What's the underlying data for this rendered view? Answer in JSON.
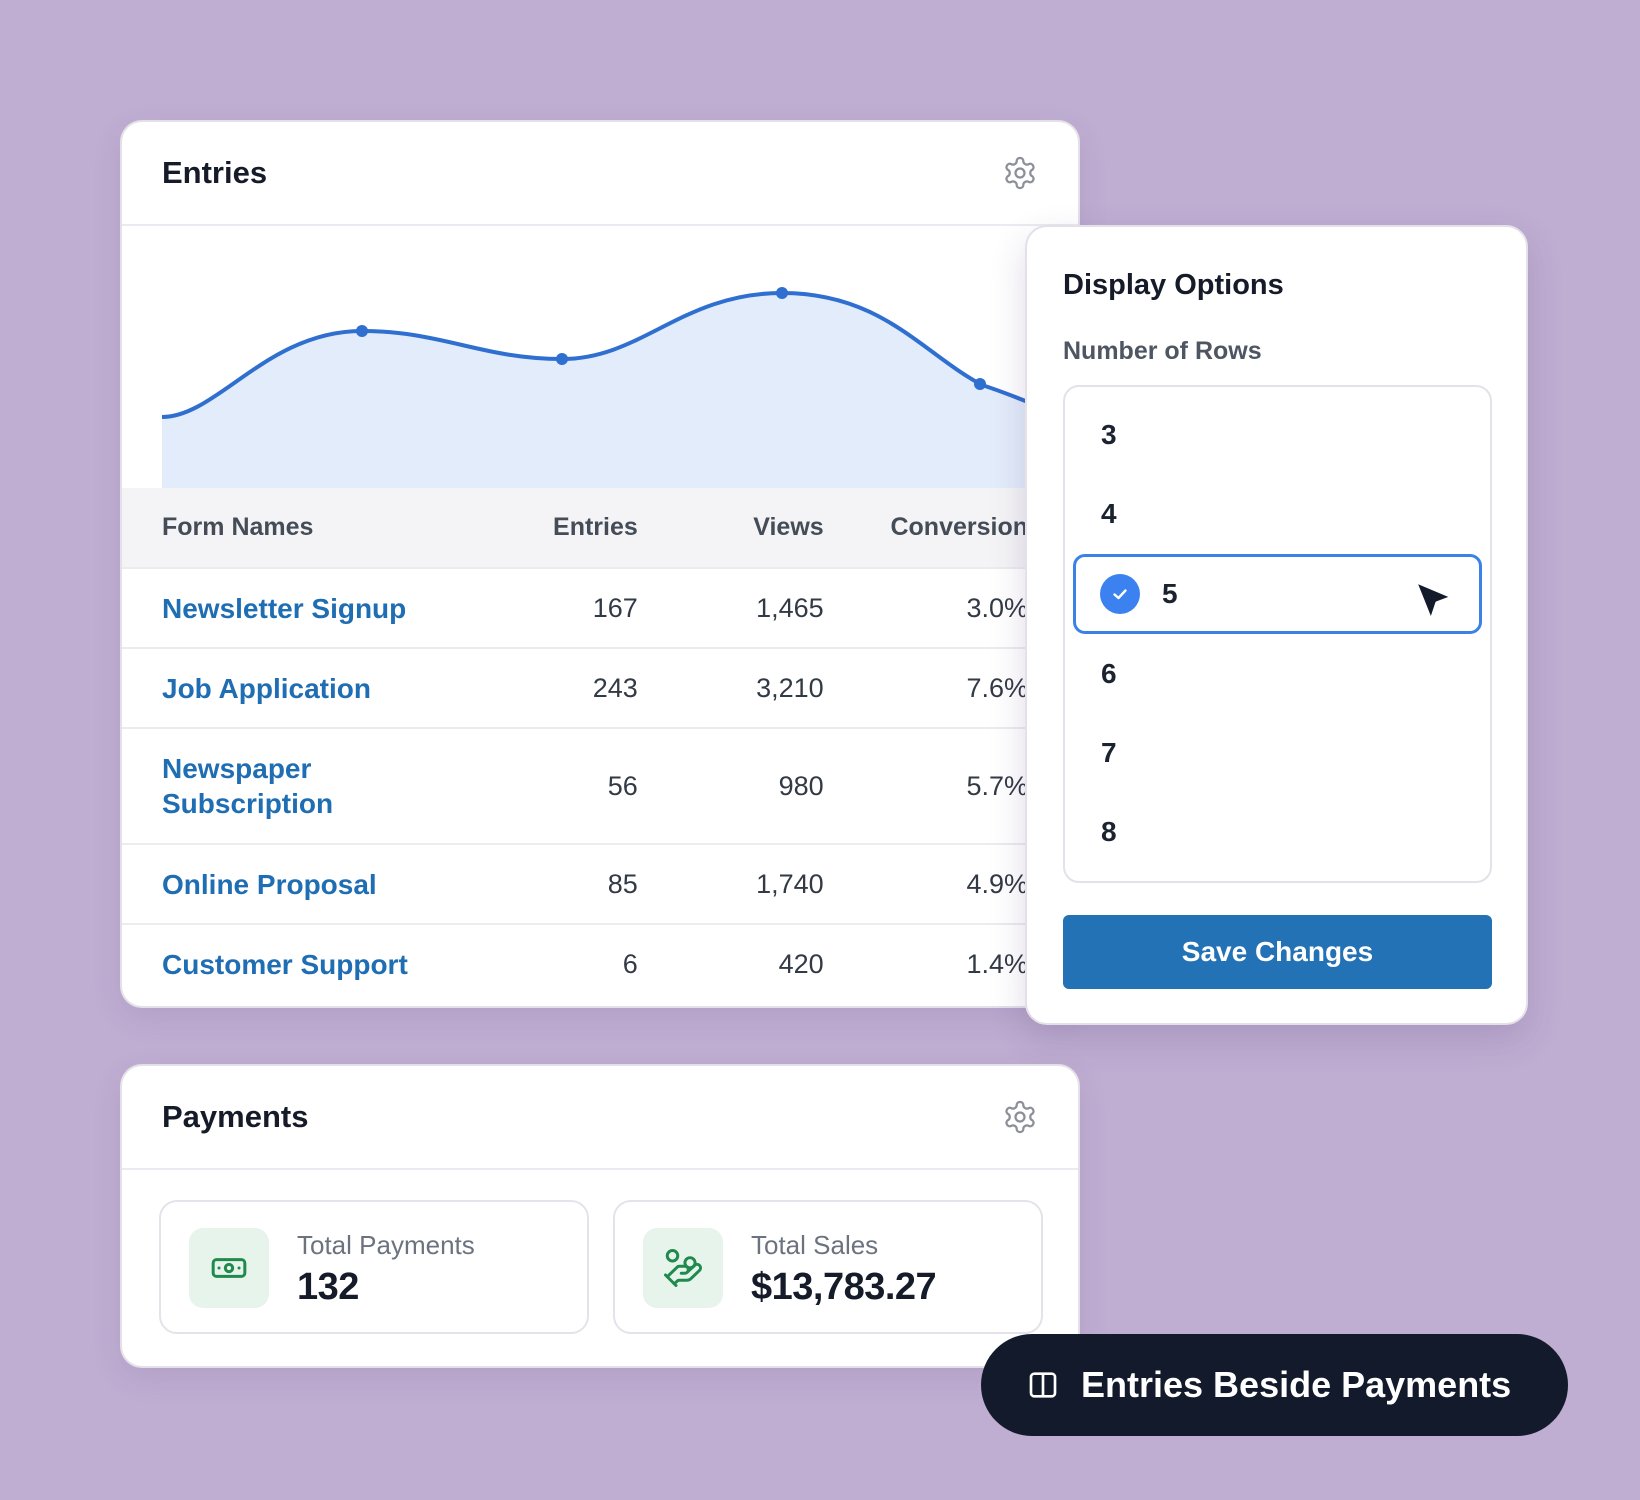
{
  "entries_card": {
    "title": "Entries",
    "settings_icon": "gear-icon",
    "chart": {
      "type": "area",
      "color": "#2f6fd0",
      "fill": "#e3ecfb"
    },
    "table": {
      "headers": {
        "name": "Form Names",
        "entries": "Entries",
        "views": "Views",
        "conversion": "Conversion"
      },
      "rows": [
        {
          "name": "Newsletter Signup",
          "entries": "167",
          "views": "1,465",
          "conversion": "3.0%"
        },
        {
          "name": "Job Application",
          "entries": "243",
          "views": "3,210",
          "conversion": "7.6%"
        },
        {
          "name": "Newspaper Subscription",
          "entries": "56",
          "views": "980",
          "conversion": "5.7%"
        },
        {
          "name": "Online Proposal",
          "entries": "85",
          "views": "1,740",
          "conversion": "4.9%"
        },
        {
          "name": "Customer Support",
          "entries": "6",
          "views": "420",
          "conversion": "1.4%"
        }
      ]
    }
  },
  "display_options": {
    "title": "Display Options",
    "rows_label": "Number of Rows",
    "options": [
      "3",
      "4",
      "5",
      "6",
      "7",
      "8"
    ],
    "selected": "5",
    "save_label": "Save Changes",
    "accent": "#3b82e6",
    "button_color": "#2372b6"
  },
  "payments_card": {
    "title": "Payments",
    "settings_icon": "gear-icon",
    "stats": [
      {
        "label": "Total Payments",
        "value": "132",
        "icon": "banknote-icon"
      },
      {
        "label": "Total Sales",
        "value": "$13,783.27",
        "icon": "hand-coins-icon"
      }
    ]
  },
  "layout_pill": {
    "label": "Entries Beside Payments",
    "icon": "columns-icon"
  },
  "colors": {
    "background": "#bfaed2",
    "link": "#1f6db3",
    "stat_icon_bg": "#e7f4ec",
    "stat_icon": "#1f8a4c",
    "pill_bg": "#121a2b"
  }
}
